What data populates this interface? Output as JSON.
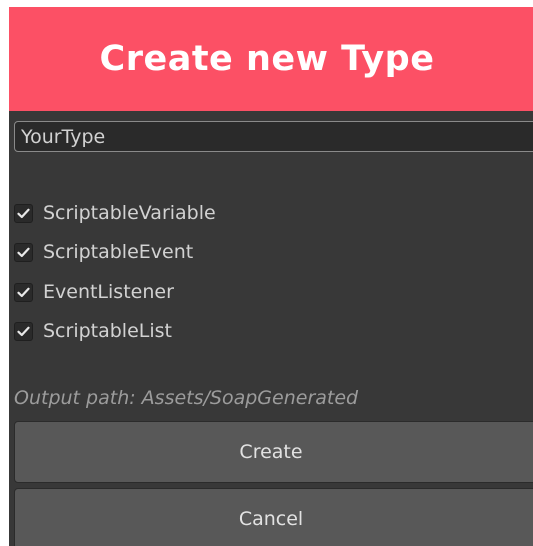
{
  "window": {
    "title": "Create new Type",
    "accent_color": "#fc5065",
    "background_color": "#383838"
  },
  "type_name": {
    "value": "YourType"
  },
  "options": [
    {
      "label": "ScriptableVariable",
      "checked": true
    },
    {
      "label": "ScriptableEvent",
      "checked": true
    },
    {
      "label": "EventListener",
      "checked": true
    },
    {
      "label": "ScriptableList",
      "checked": true
    }
  ],
  "output_path": {
    "text": "Output path: Assets/SoapGenerated"
  },
  "buttons": {
    "create_label": "Create",
    "cancel_label": "Cancel"
  },
  "icons": {
    "checkbox_mark": "checkmark-icon"
  }
}
